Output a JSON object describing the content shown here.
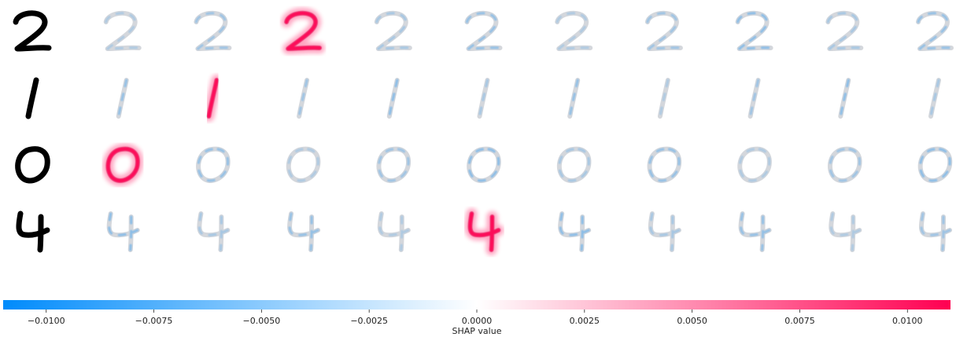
{
  "chart_data": {
    "type": "heatmap",
    "title": "",
    "input_digits": [
      "2",
      "1",
      "0",
      "4"
    ],
    "class_columns": 10,
    "shap_heatmaps": [
      {
        "input": "2",
        "highlighted_class_index": 2,
        "sign": "positive"
      },
      {
        "input": "1",
        "highlighted_class_index": 1,
        "sign": "positive"
      },
      {
        "input": "0",
        "highlighted_class_index": 0,
        "sign": "positive"
      },
      {
        "input": "4",
        "highlighted_class_index": 4,
        "sign": "positive"
      }
    ],
    "colorbar": {
      "label": "SHAP value",
      "range": [
        -0.011,
        0.011
      ],
      "ticks": [
        -0.01,
        -0.0075,
        -0.005,
        -0.0025,
        0.0,
        0.0025,
        0.005,
        0.0075,
        0.01
      ],
      "tick_labels": [
        "−0.0100",
        "−0.0075",
        "−0.0050",
        "−0.0025",
        "0.0000",
        "0.0025",
        "0.0050",
        "0.0075",
        "0.0100"
      ],
      "negative_color": "#008bfb",
      "midpoint_color": "#ffffff",
      "positive_color": "#ff0051"
    }
  }
}
